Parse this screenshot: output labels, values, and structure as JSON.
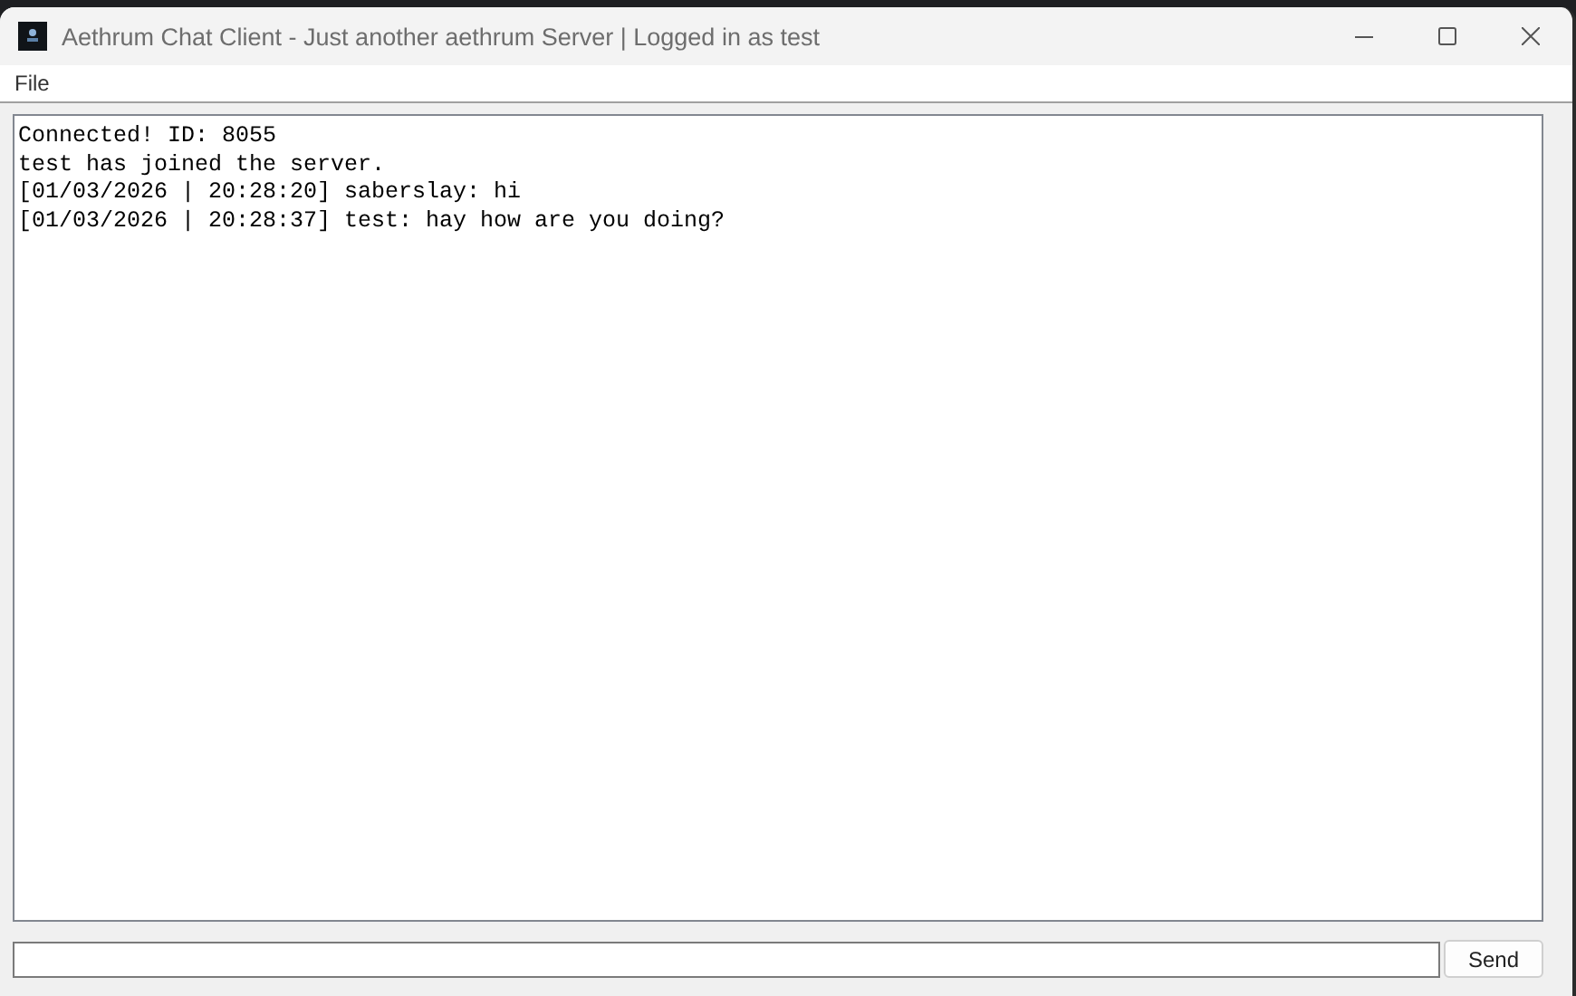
{
  "window": {
    "title": "Aethrum Chat Client - Just another aethrum Server | Logged in as test"
  },
  "menu": [
    "File"
  ],
  "chat_log": [
    "Connected! ID: 8055",
    "test has joined the server.",
    "[01/03/2026 | 20:28:20] saberslay: hi",
    "[01/03/2026 | 20:28:37] test: hay how are you doing?"
  ],
  "buttons": [
    "Send"
  ]
}
